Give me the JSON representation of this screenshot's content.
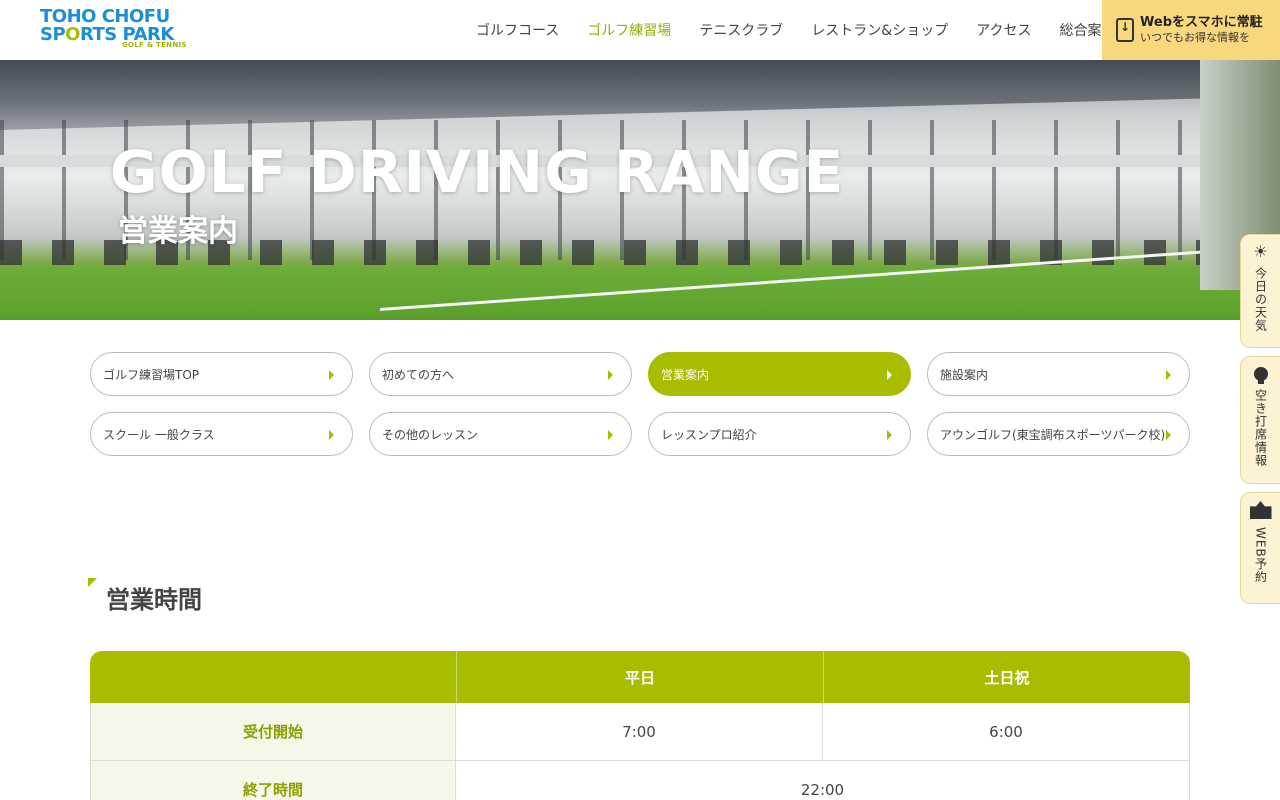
{
  "header": {
    "logo": {
      "line1": "TOHO CHOFU",
      "line2a": "SP",
      "line2b": "O",
      "line2c": "RTS PARK",
      "line3": "GOLF & TENNIS"
    },
    "nav": [
      {
        "label": "ゴルフコース"
      },
      {
        "label": "ゴルフ練習場"
      },
      {
        "label": "テニスクラブ"
      },
      {
        "label": "レストラン&ショップ"
      },
      {
        "label": "アクセス"
      },
      {
        "label": "総合案内"
      }
    ],
    "cta": {
      "title": "Webをスマホに常駐",
      "subtitle": "いつでもお得な情報を"
    }
  },
  "hero": {
    "title": "GOLF DRIVING RANGE",
    "subtitle": "営業案内"
  },
  "subnav": [
    {
      "label": "ゴルフ練習場TOP"
    },
    {
      "label": "初めての方へ"
    },
    {
      "label": "営業案内"
    },
    {
      "label": "施設案内"
    },
    {
      "label": "スクール 一般クラス"
    },
    {
      "label": "その他のレッスン"
    },
    {
      "label": "レッスンプロ紹介"
    },
    {
      "label": "アウンゴルフ(東宝調布スポーツパーク校)"
    }
  ],
  "section": {
    "title": "営業時間"
  },
  "hours_table": {
    "headers": [
      "",
      "平日",
      "土日祝"
    ],
    "rows": [
      {
        "label": "受付開始",
        "weekday": "7:00",
        "holiday": "6:00"
      },
      {
        "label": "終了時間",
        "both": "22:00"
      }
    ]
  },
  "side_widgets": [
    {
      "label": "今日の天気"
    },
    {
      "label": "空き打席情報"
    },
    {
      "label": "WEB予約"
    }
  ],
  "colors": {
    "accent": "#a8bc00",
    "logo_blue": "#1a8fd6",
    "cta_bg": "#f9d77c",
    "side_bg": "#fbf3d2"
  }
}
